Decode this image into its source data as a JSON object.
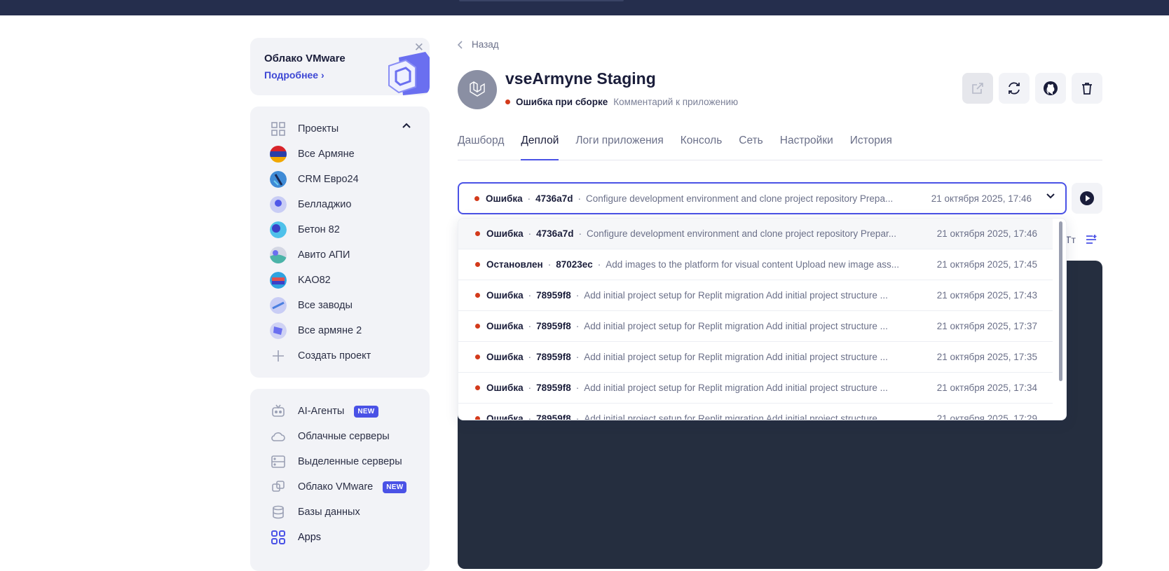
{
  "promo": {
    "title": "Облако VMware",
    "link": "Подробнее"
  },
  "projects": {
    "header": "Проекты",
    "items": [
      {
        "label": "Все Армяне"
      },
      {
        "label": "CRM Евро24"
      },
      {
        "label": "Белладжио"
      },
      {
        "label": "Бетон 82"
      },
      {
        "label": "Авито АПИ"
      },
      {
        "label": "KAO82"
      },
      {
        "label": "Все заводы"
      },
      {
        "label": "Все армяне 2"
      }
    ],
    "create": "Создать проект"
  },
  "nav": {
    "items": [
      {
        "label": "AI-Агенты",
        "badge": "NEW",
        "icon": "robot-icon"
      },
      {
        "label": "Облачные серверы",
        "icon": "cloud-icon"
      },
      {
        "label": "Выделенные серверы",
        "icon": "server-icon"
      },
      {
        "label": "Облако VMware",
        "badge": "NEW",
        "icon": "vmware-icon"
      },
      {
        "label": "Базы данных",
        "icon": "database-icon"
      },
      {
        "label": "Apps",
        "icon": "apps-icon"
      }
    ]
  },
  "back": "Назад",
  "app": {
    "title": "vseArmyne Staging",
    "status": "Ошибка при сборке",
    "comment": "Комментарий к приложению"
  },
  "tabs": [
    "Дашборд",
    "Деплой",
    "Логи приложения",
    "Консоль",
    "Сеть",
    "Настройки",
    "История"
  ],
  "selected_deploy": {
    "status": "Ошибка",
    "hash": "4736a7d",
    "message": "Configure development environment and clone project repository Prepa...",
    "date": "21 октября 2025, 17:46"
  },
  "deploys": [
    {
      "status": "Ошибка",
      "hash": "4736a7d",
      "message": "Configure development environment and clone project repository Prepar...",
      "date": "21 октября 2025, 17:46"
    },
    {
      "status": "Остановлен",
      "hash": "87023ec",
      "message": "Add images to the platform for visual content Upload new image ass...",
      "date": "21 октября 2025, 17:45"
    },
    {
      "status": "Ошибка",
      "hash": "78959f8",
      "message": "Add initial project setup for Replit migration Add initial project structure ...",
      "date": "21 октября 2025, 17:43"
    },
    {
      "status": "Ошибка",
      "hash": "78959f8",
      "message": "Add initial project setup for Replit migration Add initial project structure ...",
      "date": "21 октября 2025, 17:37"
    },
    {
      "status": "Ошибка",
      "hash": "78959f8",
      "message": "Add initial project setup for Replit migration Add initial project structure ...",
      "date": "21 октября 2025, 17:35"
    },
    {
      "status": "Ошибка",
      "hash": "78959f8",
      "message": "Add initial project setup for Replit migration Add initial project structure ...",
      "date": "21 октября 2025, 17:34"
    },
    {
      "status": "Ошибка",
      "hash": "78959f8",
      "message": "Add initial project setup for Replit migration Add initial project structure ...",
      "date": "21 октября 2025, 17:29"
    }
  ],
  "toolbar_font_label": "Тт",
  "colors": {
    "accent": "#4a52e6",
    "error": "#d33a1b",
    "topbar": "#252e4d",
    "terminal": "#252e3f"
  }
}
